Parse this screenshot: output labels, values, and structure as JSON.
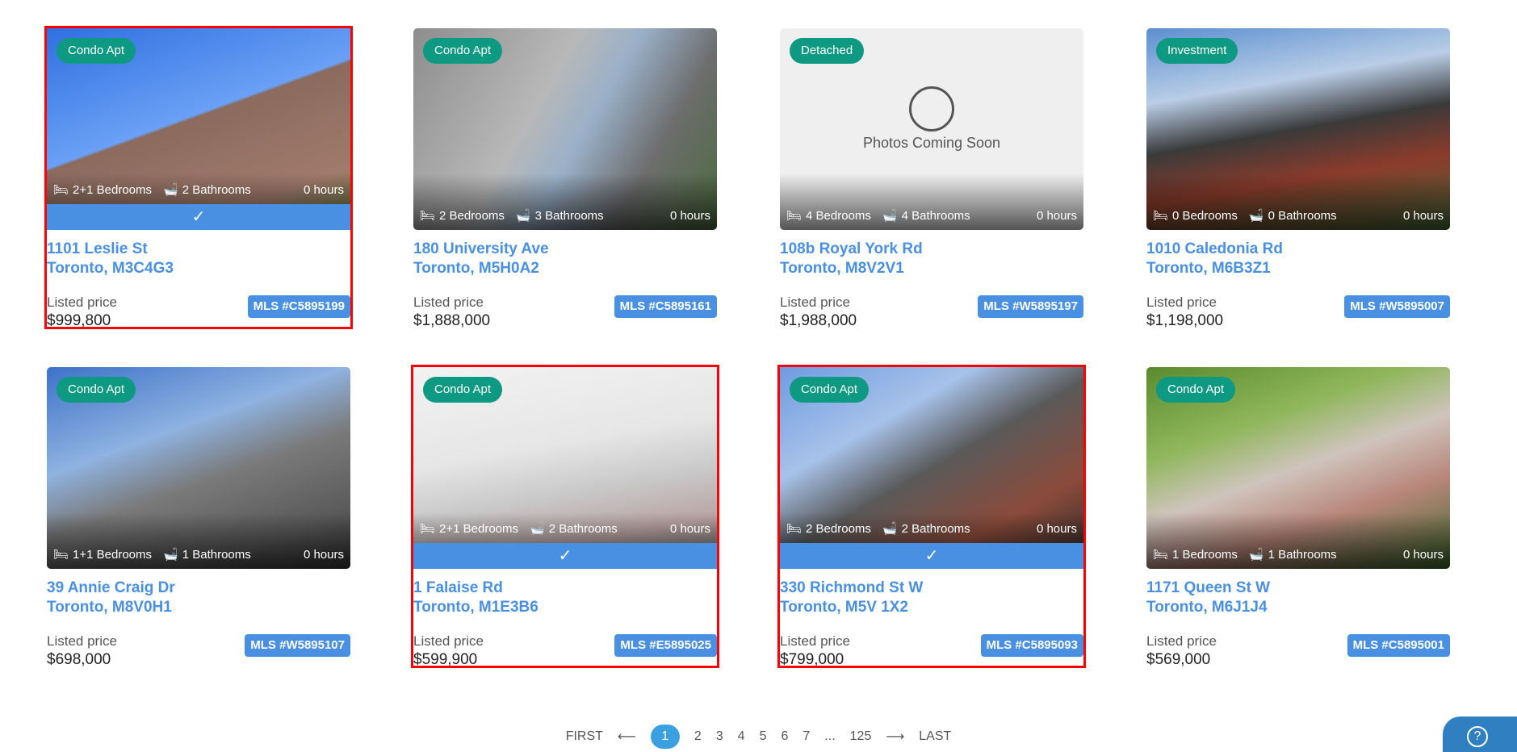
{
  "listings": [
    {
      "badge": "Condo Apt",
      "beds": "2+1 Bedrooms",
      "baths": "2 Bathrooms",
      "age": "0 hours",
      "street": "1101 Leslie St",
      "city": "Toronto, M3C4G3",
      "price_label": "Listed price",
      "price": "$999,800",
      "mls": "MLS #C5895199",
      "selected": true
    },
    {
      "badge": "Condo Apt",
      "beds": "2 Bedrooms",
      "baths": "3 Bathrooms",
      "age": "0 hours",
      "street": "180 University Ave",
      "city": "Toronto, M5H0A2",
      "price_label": "Listed price",
      "price": "$1,888,000",
      "mls": "MLS #C5895161",
      "selected": false
    },
    {
      "badge": "Detached",
      "beds": "4 Bedrooms",
      "baths": "4 Bathrooms",
      "age": "0 hours",
      "street": "108b Royal York Rd",
      "city": "Toronto, M8V2V1",
      "price_label": "Listed price",
      "price": "$1,988,000",
      "mls": "MLS #W5895197",
      "selected": false,
      "placeholder": "Photos Coming Soon"
    },
    {
      "badge": "Investment",
      "beds": "0 Bedrooms",
      "baths": "0 Bathrooms",
      "age": "0 hours",
      "street": "1010 Caledonia Rd",
      "city": "Toronto, M6B3Z1",
      "price_label": "Listed price",
      "price": "$1,198,000",
      "mls": "MLS #W5895007",
      "selected": false
    },
    {
      "badge": "Condo Apt",
      "beds": "1+1 Bedrooms",
      "baths": "1 Bathrooms",
      "age": "0 hours",
      "street": "39 Annie Craig Dr",
      "city": "Toronto, M8V0H1",
      "price_label": "Listed price",
      "price": "$698,000",
      "mls": "MLS #W5895107",
      "selected": false
    },
    {
      "badge": "Condo Apt",
      "beds": "2+1 Bedrooms",
      "baths": "2 Bathrooms",
      "age": "0 hours",
      "street": "1 Falaise Rd",
      "city": "Toronto, M1E3B6",
      "price_label": "Listed price",
      "price": "$599,900",
      "mls": "MLS #E5895025",
      "selected": true
    },
    {
      "badge": "Condo Apt",
      "beds": "2 Bedrooms",
      "baths": "2 Bathrooms",
      "age": "0 hours",
      "street": "330 Richmond St W",
      "city": "Toronto, M5V 1X2",
      "price_label": "Listed price",
      "price": "$799,000",
      "mls": "MLS #C5895093",
      "selected": true
    },
    {
      "badge": "Condo Apt",
      "beds": "1 Bedrooms",
      "baths": "1 Bathrooms",
      "age": "0 hours",
      "street": "1171 Queen St W",
      "city": "Toronto, M6J1J4",
      "price_label": "Listed price",
      "price": "$569,000",
      "mls": "MLS #C5895001",
      "selected": false
    }
  ],
  "colors": {
    "badge": "#0e9982",
    "accent": "#4a90e2",
    "selection": "#ff0000"
  },
  "pagination": {
    "first": "FIRST",
    "prev": "⟵",
    "pages": [
      "1",
      "2",
      "3",
      "4",
      "5",
      "6",
      "7",
      "...",
      "125"
    ],
    "current": "1",
    "next": "⟶",
    "last": "LAST"
  },
  "help": {
    "icon": "help-icon",
    "label": "?"
  }
}
